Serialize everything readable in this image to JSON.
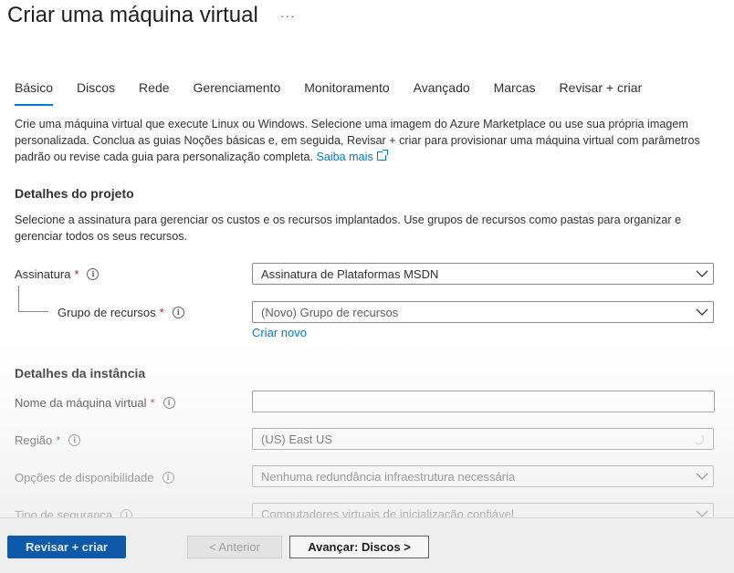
{
  "header": {
    "title": "Criar uma máquina virtual",
    "more_label": "···"
  },
  "tabs": [
    {
      "label": "Básico",
      "active": true
    },
    {
      "label": "Discos"
    },
    {
      "label": "Rede"
    },
    {
      "label": "Gerenciamento"
    },
    {
      "label": "Monitoramento"
    },
    {
      "label": "Avançado"
    },
    {
      "label": "Marcas"
    },
    {
      "label": "Revisar + criar"
    }
  ],
  "intro": {
    "text": "Crie uma máquina virtual que execute Linux ou Windows. Selecione uma imagem do Azure Marketplace ou use sua própria imagem personalizada. Conclua as guias Noções básicas e, em seguida, Revisar + criar para provisionar uma máquina virtual com parâmetros padrão ou revise cada guia para personalização completa.",
    "link": "Saiba mais"
  },
  "project": {
    "heading": "Detalhes do projeto",
    "description": "Selecione a assinatura para gerenciar os custos e os recursos implantados. Use grupos de recursos como pastas para organizar e gerenciar todos os seus recursos.",
    "subscription_label": "Assinatura",
    "subscription_value": "Assinatura de Plataformas MSDN",
    "resource_group_label": "Grupo de recursos",
    "resource_group_placeholder": "(Novo) Grupo de recursos",
    "create_new_link": "Criar novo"
  },
  "instance": {
    "heading": "Detalhes da instância",
    "vm_name_label": "Nome da máquina virtual",
    "vm_name_value": "",
    "region_label": "Região",
    "region_value": "(US) East US",
    "availability_label": "Opções de disponibilidade",
    "availability_value": "Nenhuma redundância infraestrutura necessária",
    "security_label": "Tipo de segurança",
    "security_value": "Computadores virtuais de inicialização confiável"
  },
  "common": {
    "required_mark": "*",
    "info_glyph": "i"
  },
  "footer": {
    "review_create": "Revisar + criar",
    "previous": "< Anterior",
    "next": "Avançar: Discos >"
  },
  "colors": {
    "accent": "#0078d4",
    "required": "#a4262c",
    "primary_button": "#0e5aa8"
  }
}
